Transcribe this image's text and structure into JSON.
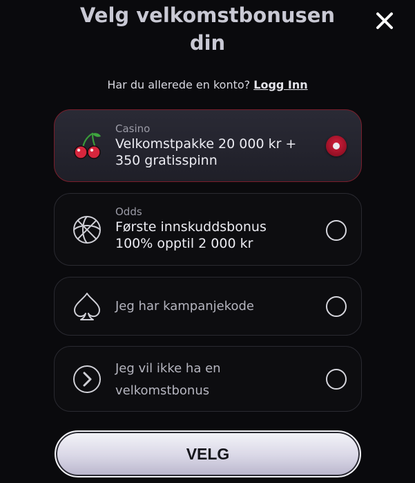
{
  "header": {
    "title_line1": "Velg velkomstbonusen",
    "title_line2": "din",
    "close_icon": "close-icon"
  },
  "login": {
    "prompt": "Har du allerede en konto?",
    "link_label": "Logg Inn"
  },
  "options": [
    {
      "category": "Casino",
      "title_line1": "Velkomstpakke 20 000 kr +",
      "title_line2": "350 gratisspinn",
      "icon": "cherry-icon",
      "selected": true
    },
    {
      "category": "Odds",
      "title_line1": "Første innskuddsbonus",
      "title_line2": "100% opptil 2 000 kr",
      "icon": "basketball-icon",
      "selected": false
    },
    {
      "category": "",
      "title_line1": "Jeg har kampanjekode",
      "title_line2": "",
      "icon": "spade-icon",
      "selected": false
    },
    {
      "category": "",
      "title_line1": "Jeg vil ikke ha en",
      "title_line2": "velkomstbonus",
      "icon": "chevron-right-icon",
      "selected": false
    }
  ],
  "submit": {
    "label": "VELG"
  },
  "colors": {
    "accent_red": "#b0162e",
    "background": "#0a0a0d"
  }
}
